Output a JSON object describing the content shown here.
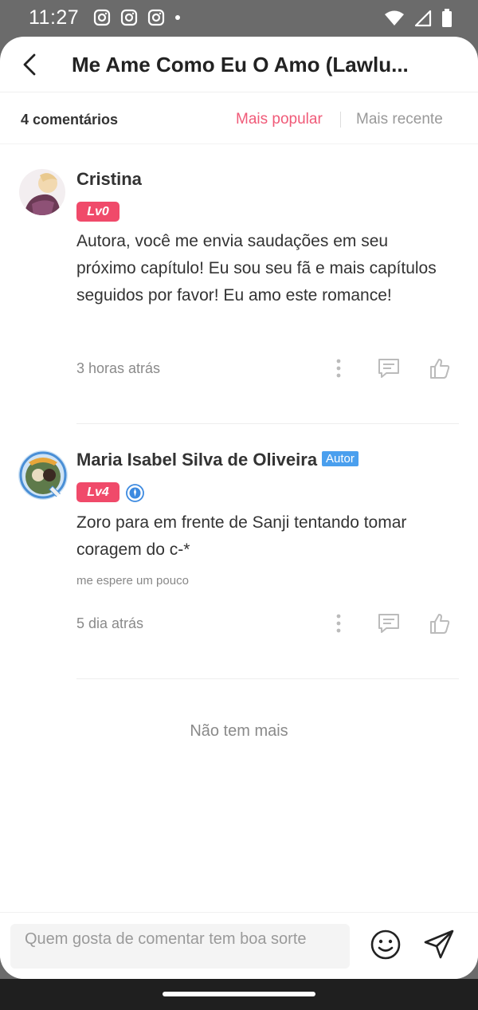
{
  "status_bar": {
    "time": "11:27",
    "left_icons": [
      "instagram-icon",
      "instagram-icon",
      "instagram-icon",
      "dot-icon"
    ],
    "right_icons": [
      "wifi-icon",
      "signal-icon",
      "battery-icon"
    ]
  },
  "header": {
    "title": "Me Ame Como Eu O Amo (Lawlu..."
  },
  "subheader": {
    "count_label": "4 comentários",
    "sort_popular": "Mais popular",
    "sort_recent": "Mais recente",
    "active_sort_color": "#f05a78"
  },
  "comments": [
    {
      "username": "Cristina",
      "level": "Lv0",
      "text": "Autora, você me envia saudações em seu próximo capítulo! Eu sou seu fã e mais capítulos seguidos por favor! Eu amo este romance!",
      "time": "3 horas atrás"
    },
    {
      "username": "Maria Isabel Silva de Oliveira",
      "author_tag": "Autor",
      "level": "Lv4",
      "text": "Zoro para em frente de Sanji tentando tomar coragem do c-*",
      "subtext": "me espere um pouco",
      "time": "5 dia atrás"
    }
  ],
  "end_message": "Não tem mais",
  "input": {
    "placeholder": "Quem gosta de comentar tem boa sorte"
  },
  "colors": {
    "accent": "#f05a78",
    "level_badge": "#f04a6a",
    "author_tag": "#4a9fee"
  }
}
